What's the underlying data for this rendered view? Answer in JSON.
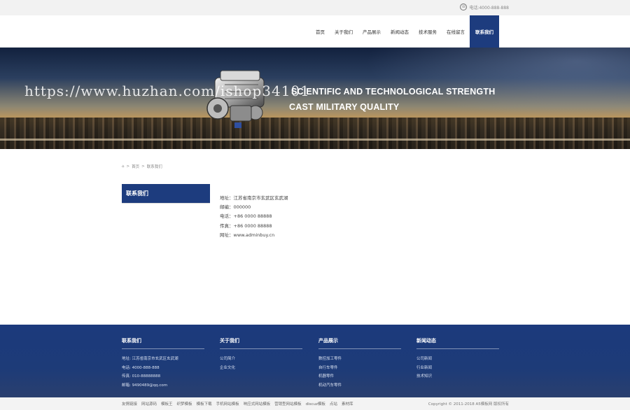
{
  "topbar": {
    "phone_label": "电话:4000-888-888",
    "phone_icon": "phone-icon"
  },
  "nav": {
    "items": [
      {
        "label": "首页"
      },
      {
        "label": "关于我们"
      },
      {
        "label": "产品展示"
      },
      {
        "label": "新闻动态"
      },
      {
        "label": "技术服务"
      },
      {
        "label": "在线留言"
      },
      {
        "label": "联系我们"
      }
    ],
    "active_index": 6,
    "active_color": "#1d3c7e"
  },
  "banner": {
    "line1": "SCIENTIFIC AND TECHNOLOGICAL STRENGTH",
    "line2": "CAST MILITARY QUALITY",
    "watermark": "https://www.huzhan.com/ishop34101"
  },
  "breadcrumb": {
    "home_icon": "home-icon",
    "sep": ">",
    "home": "首页",
    "current": "联系我们"
  },
  "sidebar": {
    "title": "联系我们"
  },
  "contact": {
    "lines": [
      "地址：江苏省南京市玄武区玄武湖",
      "邮编：000000",
      "电话：+86 0000 88888",
      "传真：+86 0000 88888",
      "网址：www.adminbuy.cn"
    ]
  },
  "footer": {
    "columns": [
      {
        "title": "联系我们",
        "rows": [
          "地址: 江苏省南京市玄武区玄武湖",
          "电话: 4000-888-888",
          "传真: 010-88888888",
          "邮箱: 9490489@qq.com"
        ]
      },
      {
        "title": "关于我们",
        "rows": [
          "公司简介",
          "企业文化"
        ]
      },
      {
        "title": "产品展示",
        "rows": [
          "数控加工零件",
          "自行车零件",
          "机器零件",
          "机动汽车零件"
        ]
      },
      {
        "title": "新闻动态",
        "rows": [
          "公司新闻",
          "行业新闻",
          "技术知识"
        ]
      }
    ],
    "bottom_links": [
      "友情链接",
      "网站源码",
      "模板王",
      "织梦模板",
      "模板下载",
      "手机网站模板",
      "响应式网站模板",
      "营销型网站模板",
      "discuz模板",
      "点站",
      "素材库"
    ],
    "copyright": "Copyright © 2011-2018 A5模板网 版权所有"
  }
}
